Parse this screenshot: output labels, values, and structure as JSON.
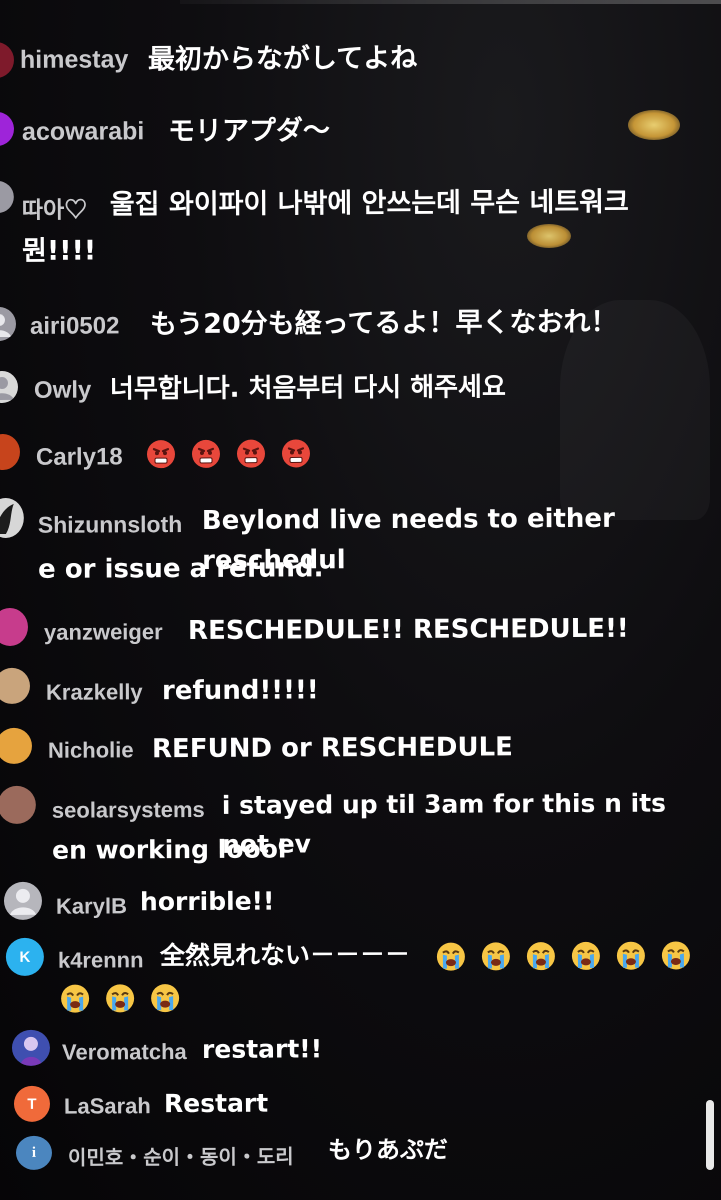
{
  "colors": {
    "background": "#0a090b",
    "username": "#c9c9cc",
    "message": "#ffffff",
    "lamp_reflection": "#ffe27a",
    "avatar_purple": "#9e24d9",
    "avatar_grey": "#9b9aa3",
    "avatar_blue": "#2cb2ef",
    "avatar_orange": "#f06a3a",
    "avatar_steel": "#4b86bf"
  },
  "chat": {
    "messages": [
      {
        "username": "himestay",
        "text": "最初からながしてよね",
        "avatar_icon": "avatar-image",
        "avatar_color": "#7e1a2b"
      },
      {
        "username": "acowarabi",
        "text": "モリアプダ〜",
        "avatar_icon": "avatar-image",
        "avatar_color": "#9e24d9"
      },
      {
        "username": "따아♡",
        "text": "울집 와이파이 나밖에 안쓰는데 무슨 네트워크",
        "text2": "뭔!!!!",
        "avatar_icon": "avatar-image",
        "avatar_color": "#9b9aa3"
      },
      {
        "username": "airi0502",
        "text": "もう20分も経ってるよ！早くなおれ！",
        "avatar_icon": "default-user-icon",
        "avatar_color": "#9b9aa3"
      },
      {
        "username": "Owly",
        "text": "너무합니다. 처음부터 다시 해주세요",
        "avatar_icon": "default-user-icon",
        "avatar_color": "#d9d9d9"
      },
      {
        "username": "Carly18",
        "text": "",
        "emojis": [
          "angry-face-emoji",
          "angry-face-emoji",
          "angry-face-emoji",
          "angry-face-emoji"
        ],
        "avatar_icon": "avatar-image",
        "avatar_color": "#c7441c"
      },
      {
        "username": "Shizunnsloth",
        "text": "Beylond live needs to either reschedul",
        "text2": "e or issue a refund.",
        "avatar_icon": "avatar-image",
        "avatar_color": "#d7d7d7"
      },
      {
        "username": "yanzweiger",
        "text": "RESCHEDULE!! RESCHEDULE!!",
        "avatar_icon": "avatar-image",
        "avatar_color": "#c73c8c"
      },
      {
        "username": "Krazkelly",
        "text": "refund!!!!!",
        "avatar_icon": "avatar-image",
        "avatar_color": "#c9a47c"
      },
      {
        "username": "Nicholie",
        "text": "REFUND or RESCHEDULE",
        "avatar_icon": "avatar-image",
        "avatar_color": "#e6a33e"
      },
      {
        "username": "seolarsystems",
        "text": "i stayed up til 3am for this n its not ev",
        "text2": "en working loool",
        "avatar_icon": "avatar-image",
        "avatar_color": "#9b6a5c"
      },
      {
        "username": "KarylB",
        "text": "horrible!!",
        "avatar_icon": "default-user-icon",
        "avatar_color": "#b6b6bc"
      },
      {
        "username": "k4rennn",
        "text": "全然見れない－－－－",
        "emojis": [
          "crying-face-emoji",
          "crying-face-emoji",
          "crying-face-emoji",
          "crying-face-emoji",
          "crying-face-emoji",
          "crying-face-emoji"
        ],
        "emojis2": [
          "crying-face-emoji",
          "crying-face-emoji",
          "crying-face-emoji"
        ],
        "avatar_letter": "K",
        "avatar_icon": "letter-avatar",
        "avatar_color": "#2cb2ef"
      },
      {
        "username": "Veromatcha",
        "text": "restart!!",
        "avatar_icon": "avatar-image",
        "avatar_color": "#3f4fb0"
      },
      {
        "username": "LaSarah",
        "text": "Restart",
        "avatar_letter": "T",
        "avatar_icon": "letter-avatar",
        "avatar_color": "#f06a3a"
      },
      {
        "username": "이민호・순이・동이・도리",
        "text": "もりあぷだ",
        "avatar_letter": "i",
        "avatar_icon": "letter-avatar",
        "avatar_color": "#4b86bf"
      }
    ]
  }
}
